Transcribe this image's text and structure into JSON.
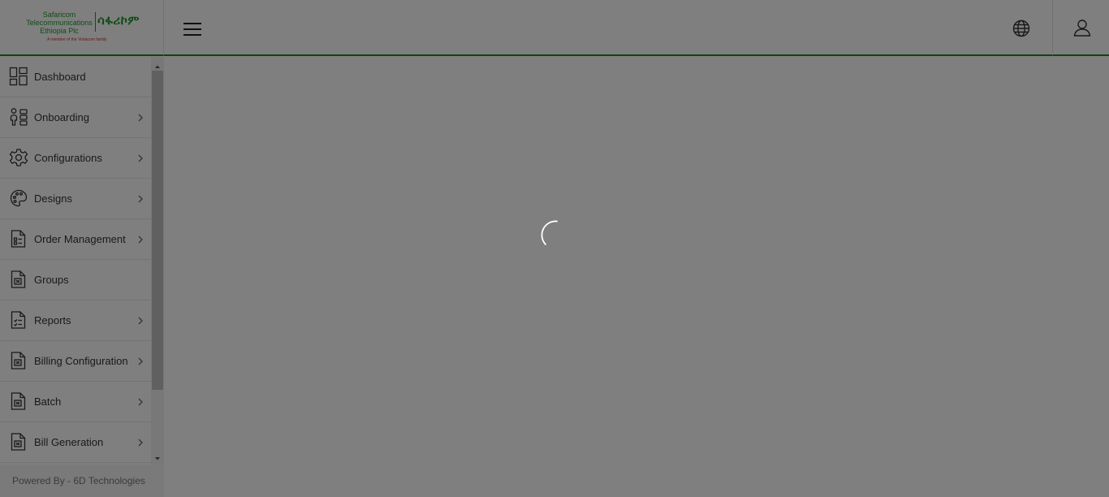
{
  "header": {
    "logo": {
      "line1": "Safaricom",
      "line2": "Telecommunications",
      "line3": "Ethiopia Plc",
      "amharic": "ሳፋሪኮም",
      "tagline": "A member of the Vodacom family"
    },
    "menu_icon": "hamburger-icon",
    "language_icon": "globe-icon",
    "profile_icon": "user-icon"
  },
  "sidebar": {
    "items": [
      {
        "label": "Dashboard",
        "icon": "dashboard-icon",
        "has_submenu": false
      },
      {
        "label": "Onboarding",
        "icon": "users-icon",
        "has_submenu": true
      },
      {
        "label": "Configurations",
        "icon": "gear-icon",
        "has_submenu": true
      },
      {
        "label": "Designs",
        "icon": "palette-icon",
        "has_submenu": true
      },
      {
        "label": "Order Management",
        "icon": "document-list-icon",
        "has_submenu": true
      },
      {
        "label": "Groups",
        "icon": "document-icon",
        "has_submenu": false
      },
      {
        "label": "Reports",
        "icon": "report-icon",
        "has_submenu": true
      },
      {
        "label": "Billing Configuration",
        "icon": "document-icon",
        "has_submenu": true
      },
      {
        "label": "Batch",
        "icon": "document-icon",
        "has_submenu": true
      },
      {
        "label": "Bill Generation",
        "icon": "document-icon",
        "has_submenu": true
      }
    ]
  },
  "footer": {
    "text": "Powered By - 6D Technologies"
  },
  "loading": {
    "icon": "spinner-icon"
  },
  "colors": {
    "brand_green": "#1e9a2a",
    "header_border": "#1a8a1a",
    "overlay": "rgba(0,0,0,0.5)"
  }
}
